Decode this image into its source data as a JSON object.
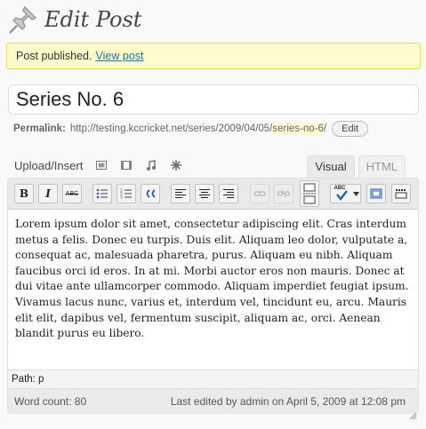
{
  "header": {
    "title": "Edit Post",
    "icon": "pushpin-icon"
  },
  "notice": {
    "message": "Post published.",
    "link_label": "View post"
  },
  "post": {
    "title": "Series No. 6",
    "permalink_label": "Permalink:",
    "permalink_base": "http://testing.kccricket.net/series/2009/04/05/",
    "permalink_slug": "series-no-6",
    "permalink_end": "/",
    "edit_label": "Edit"
  },
  "media": {
    "upload_label": "Upload/Insert"
  },
  "tabs": {
    "visual": "Visual",
    "html": "HTML"
  },
  "toolbar": {
    "bold": "B",
    "italic": "I",
    "strike": "ABC",
    "spell": "ABC"
  },
  "editor": {
    "content": "Lorem ipsum dolor sit amet, consectetur adipiscing elit. Cras interdum metus a felis. Donec eu turpis. Duis elit. Aliquam leo dolor, vulputate a, consequat ac, malesuada pharetra, purus. Aliquam eu nibh. Aliquam faucibus orci id eros. In at mi. Morbi auctor eros non mauris. Donec at dui vitae ante ullamcorper commodo. Aliquam imperdiet feugiat ipsum. Vivamus lacus nunc, varius et, interdum vel, tincidunt eu, arcu. Mauris elit elit, dapibus vel, fermentum suscipit, aliquam ac, orci. Aenean blandit purus eu libero.",
    "path": "Path: p",
    "word_count": "Word count: 80",
    "last_edited": "Last edited by admin on April 5, 2009 at 12:08 pm"
  },
  "colors": {
    "notice_bg": "#fffbcc",
    "link": "#21759b",
    "toolbar_bg": "#e9e9e9"
  }
}
